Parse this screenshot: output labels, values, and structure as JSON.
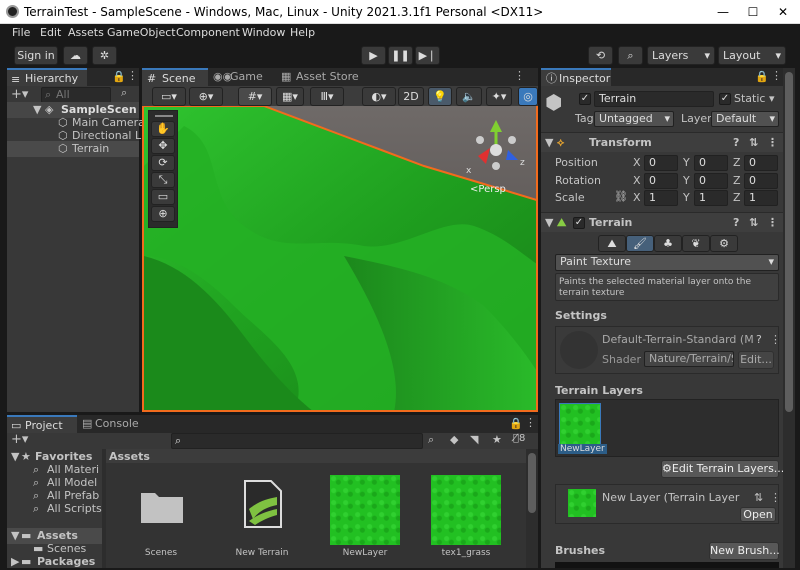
{
  "window": {
    "title": "TerrainTest - SampleScene - Windows, Mac, Linux - Unity 2021.3.1f1 Personal <DX11>",
    "min": "—",
    "max": "☐",
    "close": "✕"
  },
  "menu": [
    "File",
    "Edit",
    "Assets",
    "GameObject",
    "Component",
    "Window",
    "Help"
  ],
  "toolbar": {
    "signin": "Sign in",
    "layers": "Layers",
    "layout": "Layout"
  },
  "hierarchy": {
    "tab": "Hierarchy",
    "search_placeholder": "All",
    "scene": "SampleScen",
    "items": [
      "Main Camera",
      "Directional Lig",
      "Terrain"
    ]
  },
  "scene_tabs": {
    "scene": "Scene",
    "game": "Game",
    "asset_store": "Asset Store"
  },
  "scene_view": {
    "mode_2d": "2D",
    "persp": "Persp",
    "axis_x": "x",
    "axis_z": "z"
  },
  "inspector": {
    "tab": "Inspector",
    "object_name": "Terrain",
    "static_label": "Static",
    "tag_label": "Tag",
    "tag_value": "Untagged",
    "layer_label": "Layer",
    "layer_value": "Default",
    "transform": {
      "title": "Transform",
      "position": "Position",
      "rotation": "Rotation",
      "scale": "Scale",
      "pos": {
        "x": "0",
        "y": "0",
        "z": "0"
      },
      "rot": {
        "x": "0",
        "y": "0",
        "z": "0"
      },
      "scl": {
        "x": "1",
        "y": "1",
        "z": "1"
      }
    },
    "terrain": {
      "title": "Terrain",
      "tool": "Paint Texture",
      "help": "Paints the selected material layer onto the terrain texture",
      "settings": "Settings",
      "material": "Default-Terrain-Standard (M",
      "shader_label": "Shader",
      "shader_value": "Nature/Terrain/S",
      "edit": "Edit...",
      "layers_title": "Terrain Layers",
      "layer_name": "NewLayer",
      "edit_layers": "Edit Terrain Layers...",
      "new_layer": "New Layer (Terrain Layer",
      "open": "Open",
      "brushes": "Brushes",
      "new_brush": "New Brush..."
    }
  },
  "project": {
    "tab": "Project",
    "console": "Console",
    "hidden_count": "8",
    "favorites": "Favorites",
    "fav_items": [
      "All Materi",
      "All Model",
      "All Prefab",
      "All Scripts"
    ],
    "assets_root": "Assets",
    "asset_children": [
      "Scenes"
    ],
    "packages": "Packages",
    "breadcrumb": "Assets",
    "assets": [
      {
        "name": "Scenes",
        "kind": "folder"
      },
      {
        "name": "New Terrain",
        "kind": "terrain"
      },
      {
        "name": "NewLayer",
        "kind": "grass"
      },
      {
        "name": "tex1_grass",
        "kind": "grass"
      }
    ]
  }
}
